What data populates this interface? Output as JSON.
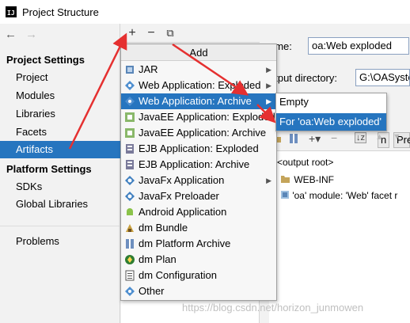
{
  "window": {
    "title": "Project Structure",
    "logo_text": "IJ"
  },
  "nav": {
    "back_glyph": "←",
    "forward_glyph": "→"
  },
  "sidebar": {
    "project_settings_header": "Project Settings",
    "project_items": [
      "Project",
      "Modules",
      "Libraries",
      "Facets",
      "Artifacts"
    ],
    "selected": "Artifacts",
    "platform_settings_header": "Platform Settings",
    "platform_items": [
      "SDKs",
      "Global Libraries"
    ],
    "other_items": [
      "Problems"
    ]
  },
  "toolbar": {
    "add_glyph": "+",
    "remove_glyph": "−",
    "copy_glyph": "⧉"
  },
  "right_panel": {
    "name_label": "ame:",
    "name_value": "oa:Web exploded",
    "output_dir_label": "utput directory:",
    "output_dir_value": "G:\\OASyste",
    "tab_partial_1": "n",
    "tab_partial_2": "Pre",
    "tree": {
      "root": "<output root>",
      "items": [
        "WEB-INF",
        "'oa' module: 'Web' facet r"
      ]
    }
  },
  "add_menu": {
    "title": "Add",
    "items": [
      {
        "label": "JAR",
        "icon": "jar-icon",
        "submenu": true
      },
      {
        "label": "Web Application: Exploded",
        "icon": "web-app-icon",
        "submenu": true
      },
      {
        "label": "Web Application: Archive",
        "icon": "web-app-icon",
        "submenu": true,
        "highlighted": true
      },
      {
        "label": "JavaEE Application: Exploded",
        "icon": "javaee-icon",
        "submenu": false
      },
      {
        "label": "JavaEE Application: Archive",
        "icon": "javaee-icon",
        "submenu": false
      },
      {
        "label": "EJB Application: Exploded",
        "icon": "ejb-icon",
        "submenu": false
      },
      {
        "label": "EJB Application: Archive",
        "icon": "ejb-icon",
        "submenu": false
      },
      {
        "label": "JavaFx Application",
        "icon": "javafx-icon",
        "submenu": true
      },
      {
        "label": "JavaFx Preloader",
        "icon": "javafx-icon",
        "submenu": false
      },
      {
        "label": "Android Application",
        "icon": "android-icon",
        "submenu": false
      },
      {
        "label": "dm Bundle",
        "icon": "dm-bundle-icon",
        "submenu": false
      },
      {
        "label": "dm Platform Archive",
        "icon": "dm-platform-icon",
        "submenu": false
      },
      {
        "label": "dm Plan",
        "icon": "dm-plan-icon",
        "submenu": false
      },
      {
        "label": "dm Configuration",
        "icon": "dm-config-icon",
        "submenu": false
      },
      {
        "label": "Other",
        "icon": "other-icon",
        "submenu": false
      }
    ]
  },
  "submenu": {
    "items": [
      {
        "label": "Empty",
        "highlighted": false
      },
      {
        "label": "For 'oa:Web exploded'",
        "highlighted": true
      }
    ]
  },
  "watermark": "https://blog.csdn.net/horizon_junmowen",
  "colors": {
    "accent": "#2675bf",
    "annotation_arrow": "#e53030"
  }
}
